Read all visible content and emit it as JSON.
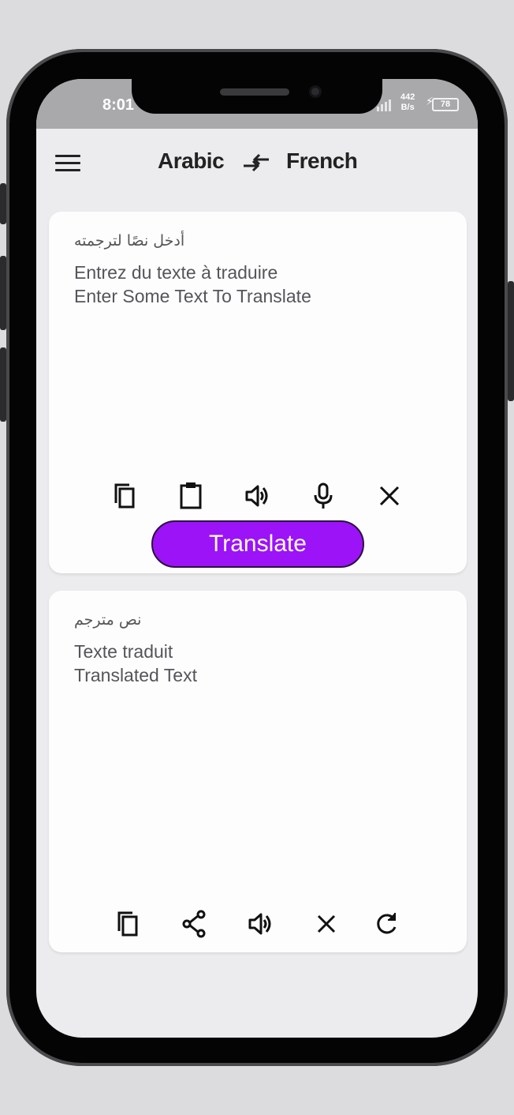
{
  "status_bar": {
    "time": "8:01",
    "net_speed_value": "442",
    "net_speed_unit": "B/s",
    "battery": "78"
  },
  "header": {
    "menu_icon": "hamburger-menu-icon",
    "source_language": "Arabic",
    "swap_icon": "swap-languages-icon",
    "target_language": "French"
  },
  "input_card": {
    "placeholder_arabic": "أدخل نصًا لترجمته",
    "placeholder_french": "Entrez du texte à traduire",
    "placeholder_english": "Enter Some Text To Translate",
    "tools": [
      "copy-icon",
      "paste-clipboard-icon",
      "speaker-icon",
      "microphone-icon",
      "clear-icon"
    ],
    "translate_label": "Translate"
  },
  "output_card": {
    "label_arabic": "نص مترجم",
    "label_french": "Texte traduit",
    "label_english": "Translated Text",
    "tools": [
      "copy-icon",
      "share-icon",
      "speaker-icon",
      "clear-icon",
      "refresh-icon"
    ]
  },
  "colors": {
    "accent": "#9c13f7",
    "background": "#ecebed",
    "card": "#fdfdfd",
    "text": "#222222"
  }
}
